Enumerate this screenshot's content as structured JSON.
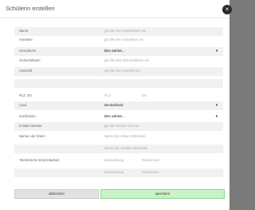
{
  "dialog": {
    "title": "Schülerin erstellen",
    "close_glyph": "×"
  },
  "fields": {
    "name": {
      "label": "Name",
      "placeholder": "gib hier den Nachnamen ein"
    },
    "vorname": {
      "label": "Vorname",
      "placeholder": "gib hier den Vornamen ein"
    },
    "geschlecht": {
      "label": "Geschlecht",
      "value": "bitte wählen..."
    },
    "geburtsdatum": {
      "label": "Geburtsdatum",
      "placeholder": "gib hier das Geburtsdatum ein"
    },
    "anschrift": {
      "label": "Anschrift",
      "placeholder": "gib hier die Anschrift ein"
    },
    "plz_ort": {
      "label": "PLZ, Ort",
      "plz_placeholder": "PLZ",
      "ort_placeholder": "Ort"
    },
    "land": {
      "label": "Land",
      "value": "Deutschland"
    },
    "konfession": {
      "label": "Konfession",
      "value": "bitte wählen..."
    },
    "email": {
      "label": "E-Mail-Adresse",
      "placeholder": "gib hier deinen Text ein"
    },
    "eltern": {
      "label": "Namen der Eltern",
      "placeholder_1": "Name des ersten Elternteils",
      "placeholder_2": "Name des zweiten Elternteils"
    },
    "telefon": {
      "label": "Telefonische Erreichbarkeit",
      "rows": [
        {
          "bezeichnung": "Bezeichnung",
          "nummer": "Rufnummer"
        },
        {
          "bezeichnung": "Bezeichnung",
          "nummer": "Rufnummer"
        }
      ]
    }
  },
  "buttons": {
    "cancel": "abbrechen",
    "save": "speichern"
  }
}
